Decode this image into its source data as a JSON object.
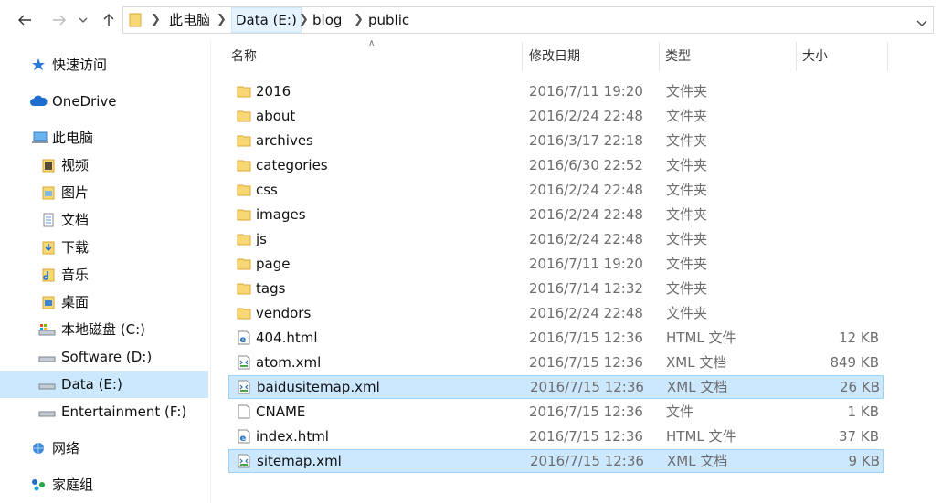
{
  "address": {
    "crumbs": [
      "此电脑",
      "Data (E:)",
      "blog",
      "public"
    ]
  },
  "nav": {
    "items": [
      {
        "label": "快速访问",
        "icon": "star-icon"
      },
      {
        "label": "OneDrive",
        "icon": "cloud-icon"
      },
      {
        "label": "此电脑",
        "icon": "computer-icon"
      },
      {
        "label": "视频",
        "icon": "video-folder-icon"
      },
      {
        "label": "图片",
        "icon": "pictures-folder-icon"
      },
      {
        "label": "文档",
        "icon": "documents-folder-icon"
      },
      {
        "label": "下载",
        "icon": "downloads-folder-icon"
      },
      {
        "label": "音乐",
        "icon": "music-folder-icon"
      },
      {
        "label": "桌面",
        "icon": "desktop-folder-icon"
      },
      {
        "label": "本地磁盘 (C:)",
        "icon": "system-drive-icon"
      },
      {
        "label": "Software (D:)",
        "icon": "drive-icon"
      },
      {
        "label": "Data (E:)",
        "icon": "drive-icon"
      },
      {
        "label": "Entertainment (F:)",
        "icon": "drive-icon"
      },
      {
        "label": "网络",
        "icon": "network-icon"
      },
      {
        "label": "家庭组",
        "icon": "homegroup-icon"
      }
    ]
  },
  "columns": {
    "name": "名称",
    "date": "修改日期",
    "type": "类型",
    "size": "大小"
  },
  "files": [
    {
      "name": "2016",
      "date": "2016/7/11 19:20",
      "type": "文件夹",
      "size": "",
      "icon": "folder-icon"
    },
    {
      "name": "about",
      "date": "2016/2/24 22:48",
      "type": "文件夹",
      "size": "",
      "icon": "folder-icon"
    },
    {
      "name": "archives",
      "date": "2016/3/17 22:18",
      "type": "文件夹",
      "size": "",
      "icon": "folder-icon"
    },
    {
      "name": "categories",
      "date": "2016/6/30 22:52",
      "type": "文件夹",
      "size": "",
      "icon": "folder-icon"
    },
    {
      "name": "css",
      "date": "2016/2/24 22:48",
      "type": "文件夹",
      "size": "",
      "icon": "folder-icon"
    },
    {
      "name": "images",
      "date": "2016/2/24 22:48",
      "type": "文件夹",
      "size": "",
      "icon": "folder-icon"
    },
    {
      "name": "js",
      "date": "2016/2/24 22:48",
      "type": "文件夹",
      "size": "",
      "icon": "folder-icon"
    },
    {
      "name": "page",
      "date": "2016/7/11 19:20",
      "type": "文件夹",
      "size": "",
      "icon": "folder-icon"
    },
    {
      "name": "tags",
      "date": "2016/7/14 12:32",
      "type": "文件夹",
      "size": "",
      "icon": "folder-icon"
    },
    {
      "name": "vendors",
      "date": "2016/2/24 22:48",
      "type": "文件夹",
      "size": "",
      "icon": "folder-icon"
    },
    {
      "name": "404.html",
      "date": "2016/7/15 12:36",
      "type": "HTML 文件",
      "size": "12 KB",
      "icon": "html-file-icon"
    },
    {
      "name": "atom.xml",
      "date": "2016/7/15 12:36",
      "type": "XML 文档",
      "size": "849 KB",
      "icon": "xml-file-icon"
    },
    {
      "name": "baidusitemap.xml",
      "date": "2016/7/15 12:36",
      "type": "XML 文档",
      "size": "26 KB",
      "icon": "xml-file-icon",
      "selected": true
    },
    {
      "name": "CNAME",
      "date": "2016/7/15 12:36",
      "type": "文件",
      "size": "1 KB",
      "icon": "blank-file-icon"
    },
    {
      "name": "index.html",
      "date": "2016/7/15 12:36",
      "type": "HTML 文件",
      "size": "37 KB",
      "icon": "html-file-icon"
    },
    {
      "name": "sitemap.xml",
      "date": "2016/7/15 12:36",
      "type": "XML 文档",
      "size": "9 KB",
      "icon": "xml-file-icon",
      "selected": true
    }
  ],
  "colors": {
    "selection_bg": "#cce8ff",
    "selection_border": "#99d1ff",
    "folder": "#f8d775",
    "ie_blue": "#1e6fc8"
  }
}
